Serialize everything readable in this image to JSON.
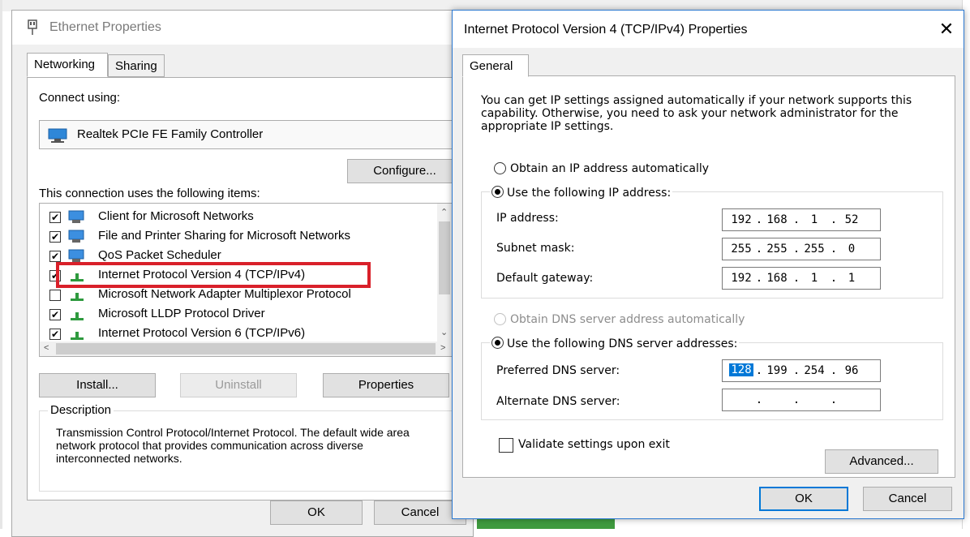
{
  "ethernet": {
    "title": "Ethernet Properties",
    "tabs": [
      "Networking",
      "Sharing"
    ],
    "connect_using_label": "Connect using:",
    "adapter_name": "Realtek PCIe FE Family Controller",
    "configure_label": "Configure...",
    "items_label": "This connection uses the following items:",
    "items": [
      {
        "label": "Client for Microsoft Networks",
        "checked": true,
        "icon": "network-client-icon"
      },
      {
        "label": "File and Printer Sharing for Microsoft Networks",
        "checked": true,
        "icon": "file-sharing-icon"
      },
      {
        "label": "QoS Packet Scheduler",
        "checked": true,
        "icon": "qos-icon"
      },
      {
        "label": "Internet Protocol Version 4 (TCP/IPv4)",
        "checked": true,
        "icon": "protocol-icon",
        "highlighted": true
      },
      {
        "label": "Microsoft Network Adapter Multiplexor Protocol",
        "checked": false,
        "icon": "protocol-icon"
      },
      {
        "label": "Microsoft LLDP Protocol Driver",
        "checked": true,
        "icon": "protocol-icon"
      },
      {
        "label": "Internet Protocol Version 6 (TCP/IPv6)",
        "checked": true,
        "icon": "protocol-icon"
      }
    ],
    "install_label": "Install...",
    "uninstall_label": "Uninstall",
    "properties_label": "Properties",
    "description_label": "Description",
    "description_text": "Transmission Control Protocol/Internet Protocol. The default wide area network protocol that provides communication across diverse interconnected networks.",
    "ok_label": "OK",
    "cancel_label": "Cancel",
    "highlight_color": "#d9202a"
  },
  "ipv4": {
    "title": "Internet Protocol Version 4 (TCP/IPv4) Properties",
    "tab": "General",
    "intro": "You can get IP settings assigned automatically if your network supports this capability. Otherwise, you need to ask your network administrator for the appropriate IP settings.",
    "obtain_ip_auto": "Obtain an IP address automatically",
    "use_following_ip": "Use the following IP address:",
    "ip_address_label": "IP address:",
    "ip_address": [
      "192",
      "168",
      "1",
      "52"
    ],
    "subnet_label": "Subnet mask:",
    "subnet": [
      "255",
      "255",
      "255",
      "0"
    ],
    "gateway_label": "Default gateway:",
    "gateway": [
      "192",
      "168",
      "1",
      "1"
    ],
    "obtain_dns_auto": "Obtain DNS server address automatically",
    "use_following_dns": "Use the following DNS server addresses:",
    "preferred_dns_label": "Preferred DNS server:",
    "preferred_dns": [
      "128",
      "199",
      "254",
      "96"
    ],
    "alternate_dns_label": "Alternate DNS server:",
    "alternate_dns": [
      "",
      "",
      "",
      ""
    ],
    "validate_label": "Validate settings upon exit",
    "validate_checked": false,
    "advanced_label": "Advanced...",
    "ok_label": "OK",
    "cancel_label": "Cancel",
    "ip_mode": "manual",
    "dns_mode": "manual",
    "accent_color": "#0078d7"
  }
}
